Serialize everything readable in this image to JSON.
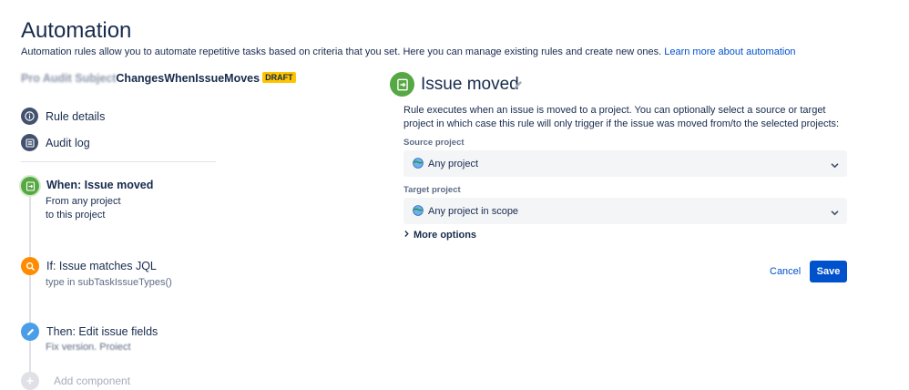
{
  "header": {
    "title": "Automation",
    "description": "Automation rules allow you to automate repetitive tasks based on criteria that you set. Here you can manage existing rules and create new ones.",
    "learn_more_link": "Learn more about automation"
  },
  "rule": {
    "name_obscured": "Pro Audit Subject",
    "name_visible": "ChangesWhenIssueMoves",
    "status_badge": "DRAFT"
  },
  "sidebar": {
    "items": [
      {
        "label": "Rule details",
        "icon": "info-icon"
      },
      {
        "label": "Audit log",
        "icon": "log-icon"
      }
    ]
  },
  "components": [
    {
      "title": "When: Issue moved",
      "lines": [
        "From any project",
        "to this project"
      ],
      "color": "#57a845",
      "icon": "issue-moved-icon"
    },
    {
      "title": "If: Issue matches JQL",
      "lines": [
        "type in subTaskIssueTypes()"
      ],
      "color": "#ff8b00",
      "icon": "search-icon"
    },
    {
      "title": "Then: Edit issue fields",
      "lines": [
        "Fix version, Project"
      ],
      "color": "#4a9ee8",
      "icon": "pencil-icon"
    }
  ],
  "add_component_label": "Add component",
  "trigger_panel": {
    "title": "Issue moved",
    "description": "Rule executes when an issue is moved to a project. You can optionally select a source or target project in which case this rule will only trigger if the issue was moved from/to the selected projects:",
    "source_project": {
      "label": "Source project",
      "value": "Any project"
    },
    "target_project": {
      "label": "Target project",
      "value": "Any project in scope"
    },
    "more_options_label": "More options",
    "cancel_label": "Cancel",
    "save_label": "Save"
  },
  "colors": {
    "accent": "#0052cc",
    "trigger": "#57a845",
    "condition": "#ff8b00",
    "action": "#4a9ee8",
    "draft_badge": "#ffc400"
  }
}
